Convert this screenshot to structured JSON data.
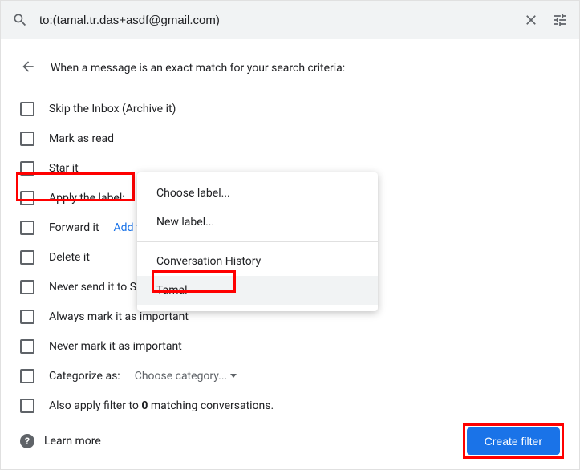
{
  "search": {
    "value": "to:(tamal.tr.das+asdf@gmail.com)"
  },
  "header": {
    "title": "When a message is an exact match for your search criteria:"
  },
  "options": {
    "skip": "Skip the Inbox (Archive it)",
    "read": "Mark as read",
    "star": "Star it",
    "apply": "Apply the label:",
    "forward": "Forward it",
    "forward_link": "Add forwarding address",
    "delete": "Delete it",
    "never_spam": "Never send it to Spam",
    "always_imp": "Always mark it as important",
    "never_imp": "Never mark it as important",
    "categorize": "Categorize as:",
    "categorize_choose": "Choose category...",
    "also_apply_pre": "Also apply filter to ",
    "also_apply_count": "0",
    "also_apply_post": " matching conversations."
  },
  "dropdown": {
    "choose": "Choose label...",
    "new": "New label...",
    "conv": "Conversation History",
    "tamal": "Tamal"
  },
  "footer": {
    "learn": "Learn more",
    "create": "Create filter"
  }
}
